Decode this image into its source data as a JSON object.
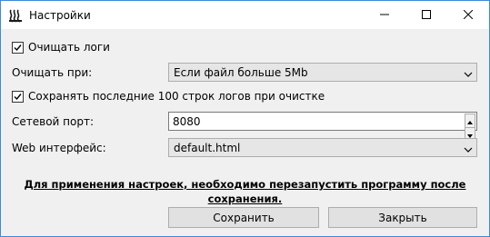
{
  "window": {
    "title": "Настройки",
    "app_icon": "steam-icon",
    "controls": [
      "minimize-icon",
      "maximize-icon",
      "close-icon"
    ]
  },
  "settings": {
    "clear_logs": {
      "label": "Очищать логи",
      "checked": true
    },
    "clear_when": {
      "label": "Очищать при:",
      "value": "Если файл больше 5Mb"
    },
    "keep_last": {
      "label": "Сохранять последние 100 строк логов при очистке",
      "checked": true
    },
    "network_port": {
      "label": "Сетевой порт:",
      "value": "8080"
    },
    "web_ui": {
      "label": "Web интерфейс:",
      "value": "default.html"
    }
  },
  "notice": "Для применения настроек, необходимо перезапустить программу после сохранения.",
  "buttons": {
    "save": "Сохранить",
    "close": "Закрыть"
  },
  "colors": {
    "window_border": "#3c8ad8",
    "dialog_bg": "#f0f0f0",
    "button_bg": "#e1e1e1",
    "combo_bg": "#e6e6e6"
  }
}
